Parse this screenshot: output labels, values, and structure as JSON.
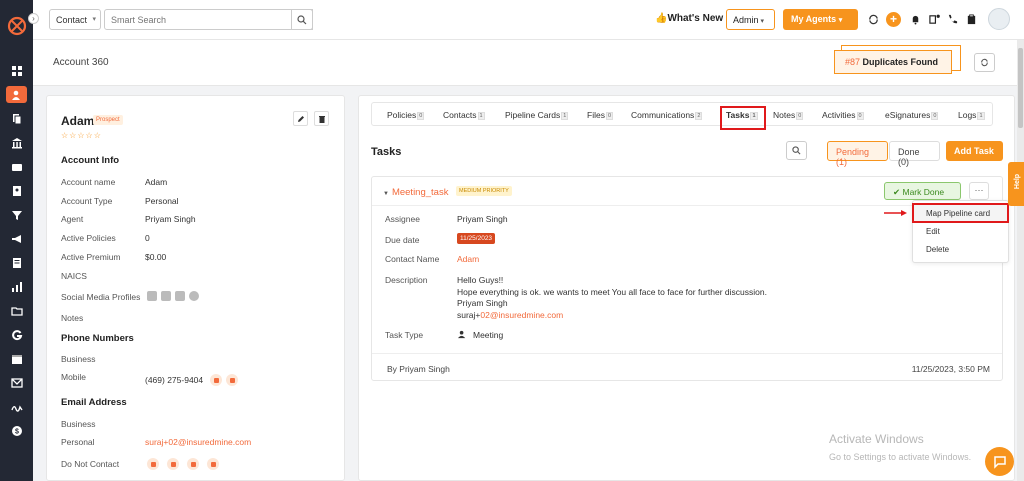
{
  "sidebar": {
    "items": [
      {
        "icon": "dashboard-icon"
      },
      {
        "icon": "contacts-icon",
        "active": true
      },
      {
        "icon": "copy-icon"
      },
      {
        "icon": "bank-icon"
      },
      {
        "icon": "wallet-icon"
      },
      {
        "icon": "id-card-icon"
      },
      {
        "icon": "funnel-icon"
      },
      {
        "icon": "megaphone-icon"
      },
      {
        "icon": "document-icon"
      },
      {
        "icon": "chart-icon"
      },
      {
        "icon": "folder-icon"
      },
      {
        "icon": "g-logo-icon"
      },
      {
        "icon": "calendar-icon"
      },
      {
        "icon": "mail-icon"
      },
      {
        "icon": "signature-icon"
      },
      {
        "icon": "dollar-icon"
      }
    ]
  },
  "topbar": {
    "contact_select": "Contact",
    "search_placeholder": "Smart Search",
    "whats_new": "👍What's New",
    "admin": "Admin",
    "my_agents": "My Agents",
    "plus": "+"
  },
  "subheader": {
    "title": "Account 360",
    "dup_number": "#87",
    "dup_text": "Duplicates Found"
  },
  "profile": {
    "name": "Adam",
    "badge": "Prospect",
    "stars": "☆☆☆☆☆",
    "account_info_title": "Account Info",
    "fields": [
      {
        "label": "Account name",
        "value": "Adam"
      },
      {
        "label": "Account Type",
        "value": "Personal"
      },
      {
        "label": "Agent",
        "value": "Priyam Singh"
      },
      {
        "label": "Active Policies",
        "value": "0"
      },
      {
        "label": "Active Premium",
        "value": "$0.00"
      },
      {
        "label": "NAICS",
        "value": ""
      },
      {
        "label": "Social Media Profiles",
        "value": ""
      },
      {
        "label": "Notes",
        "value": ""
      }
    ],
    "phone_title": "Phone Numbers",
    "business_label": "Business",
    "mobile_label": "Mobile",
    "mobile_value": "(469) 275-9404",
    "email_title": "Email Address",
    "email_business_label": "Business",
    "email_personal_label": "Personal",
    "email_personal_value": "suraj+02@insuredmine.com",
    "dnc_label": "Do Not Contact"
  },
  "tabs": [
    {
      "label": "Policies",
      "count": "0"
    },
    {
      "label": "Contacts",
      "count": "1"
    },
    {
      "label": "Pipeline Cards",
      "count": "1"
    },
    {
      "label": "Files",
      "count": "0"
    },
    {
      "label": "Communications",
      "count": "2"
    },
    {
      "label": "Tasks",
      "count": "1",
      "active": true
    },
    {
      "label": "Notes",
      "count": "0"
    },
    {
      "label": "Activities",
      "count": "0"
    },
    {
      "label": "eSignatures",
      "count": "0"
    },
    {
      "label": "Logs",
      "count": "1"
    }
  ],
  "tasks": {
    "title": "Tasks",
    "pending": "Pending (1)",
    "done": "Done (0)",
    "add": "Add Task",
    "task": {
      "name": "Meeting_task",
      "priority": "MEDIUM PRIORITY",
      "mark_done": "✔ Mark Done",
      "more": "···",
      "assignee_label": "Assignee",
      "assignee": "Priyam Singh",
      "due_label": "Due date",
      "due": "11/25/2023",
      "contact_label": "Contact Name",
      "contact": "Adam",
      "desc_label": "Description",
      "desc_line1": "Hello Guys!!",
      "desc_line2": "Hope everything is ok. we wants to meet You all face to face for further discussion.",
      "desc_line3": "Priyam Singh",
      "desc_line4_prefix": "suraj+",
      "desc_line4_link": "02@insuredmine.com",
      "type_label": "Task Type",
      "type": "Meeting",
      "by": "By Priyam Singh",
      "stamp": "11/25/2023, 3:50 PM"
    }
  },
  "dropdown": {
    "items": [
      "Map Pipeline card",
      "Edit",
      "Delete"
    ]
  },
  "help": "Help",
  "watermark": {
    "line1": "Activate Windows",
    "line2": "Go to Settings to activate Windows."
  },
  "colors": {
    "brand_orange": "#f7941d",
    "accent": "#f26a3b",
    "highlight_red": "#e0191b",
    "sidebar_bg": "#232834"
  }
}
